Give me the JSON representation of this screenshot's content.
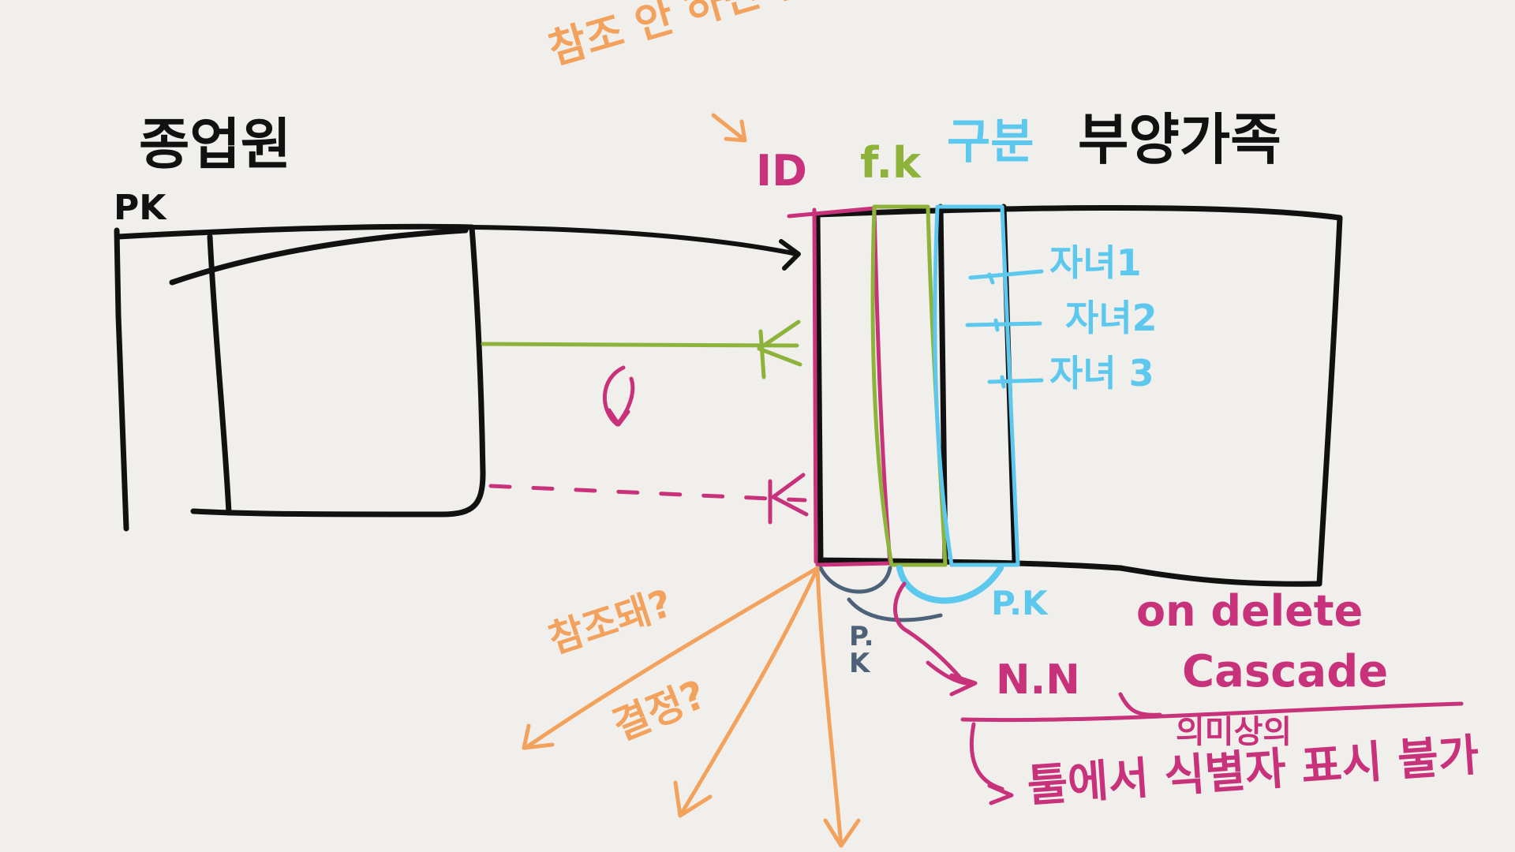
{
  "colors": {
    "background": "#f1efec",
    "ink": "#111111",
    "magenta": "#c8327a",
    "green": "#8db33a",
    "blue": "#5cc8ee",
    "orange": "#f2a25c",
    "slate": "#4d6178"
  },
  "entities": {
    "left": {
      "title": "종업원",
      "key_label": "PK"
    },
    "right": {
      "title": "부양가족"
    }
  },
  "annotations": {
    "top_note": "참조 안 하면 만들?",
    "id_label": "ID",
    "fk_label": "f.k",
    "divider_label": "구분",
    "children": [
      "자녀1",
      "자녀2",
      "자녀 3"
    ],
    "pk_blue": "P.K",
    "pk_slate": "P.K",
    "nn": "N.N",
    "on_delete": "on delete",
    "cascade": "Cascade",
    "semantic": "의미상의",
    "tool_note": "툴에서 식별자 표시 불가",
    "referenced_q": "참조돼?",
    "decide_q": "결정?"
  }
}
